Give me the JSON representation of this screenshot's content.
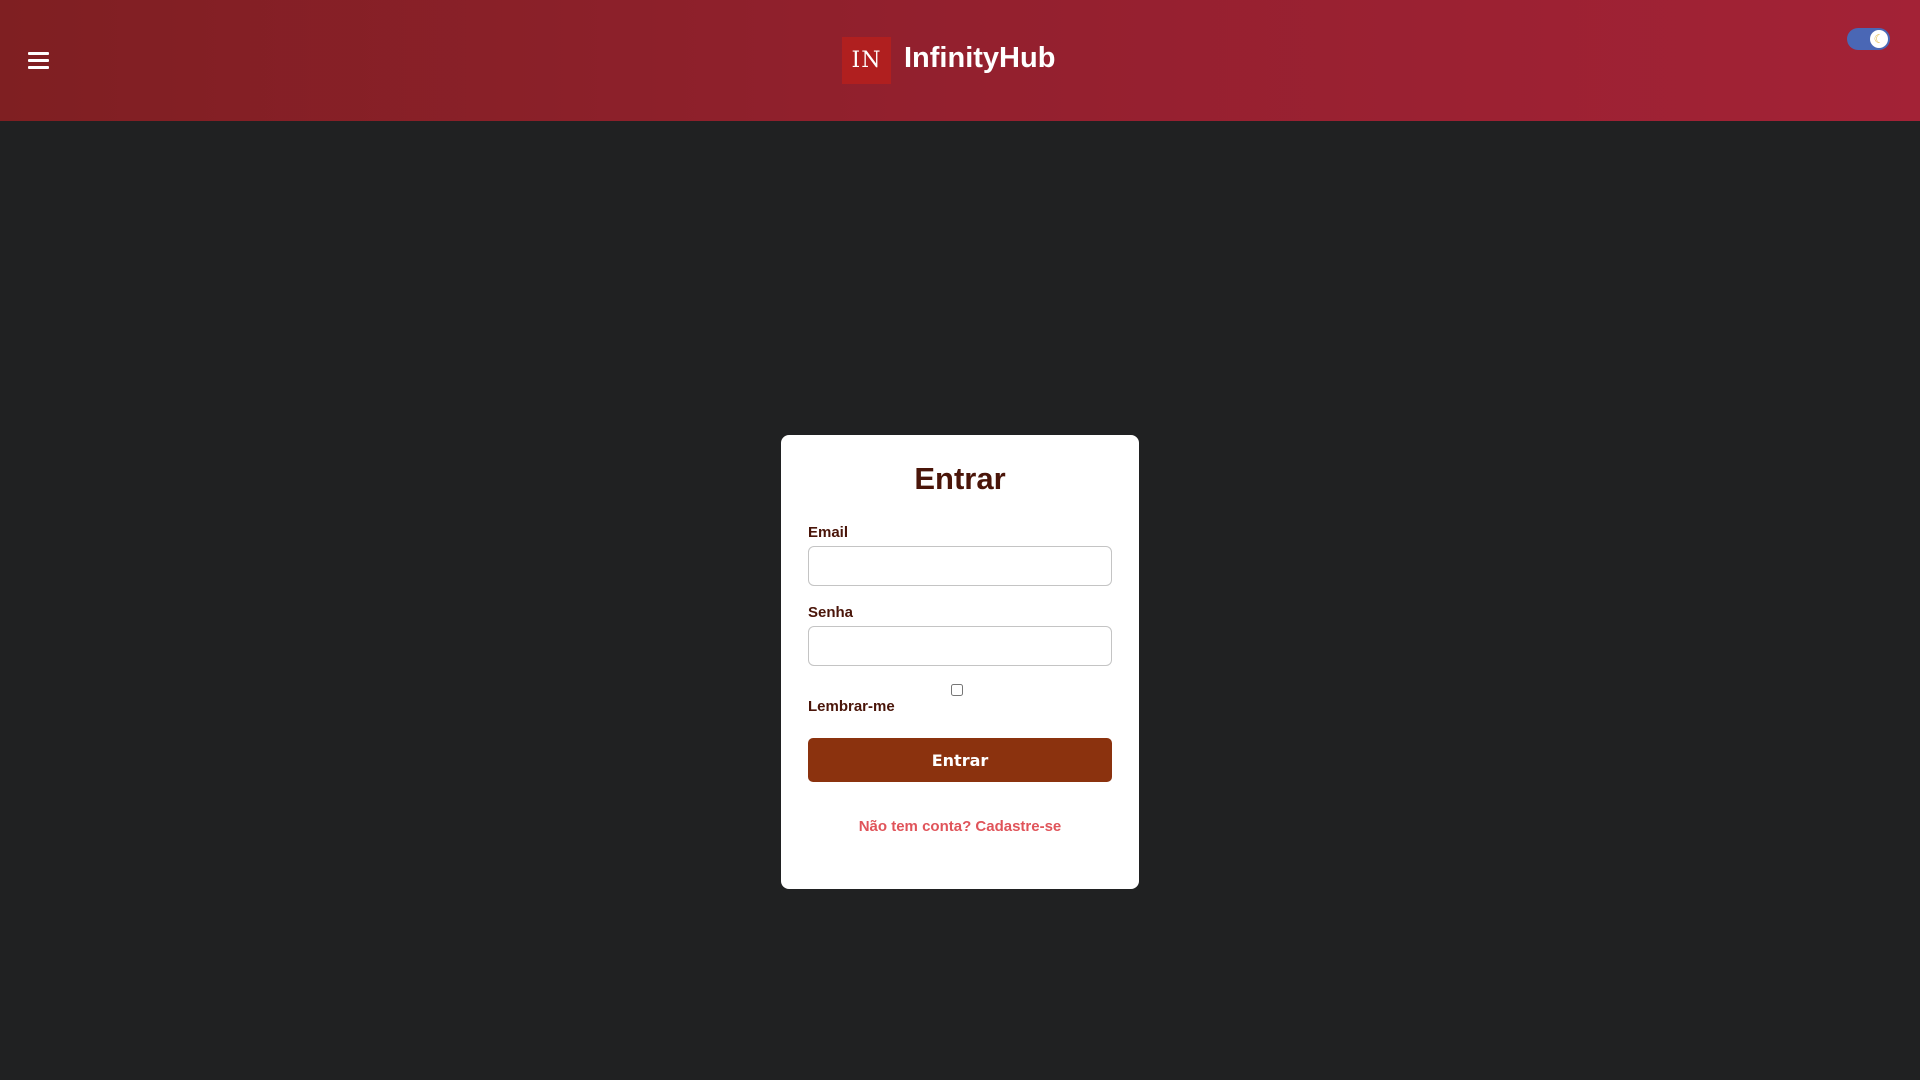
{
  "header": {
    "logo_text": "IN",
    "brand": "InfinityHub",
    "theme_toggle_icon": "moon-icon",
    "menu_icon": "hamburger-menu-icon"
  },
  "login": {
    "title": "Entrar",
    "email_label": "Email",
    "email_value": "",
    "password_label": "Senha",
    "password_value": "",
    "remember_label": "Lembrar-me",
    "remember_checked": false,
    "submit_label": "Entrar",
    "signup_link": "Não tem conta? Cadastre-se"
  },
  "colors": {
    "header_gradient_start": "#7f1f22",
    "header_gradient_end": "#a32236",
    "background": "#202122",
    "logo_box": "#b01f1f",
    "title_text": "#4a1509",
    "submit_button": "#8b320e",
    "link": "#e0545a",
    "toggle": "#4a67b5"
  }
}
